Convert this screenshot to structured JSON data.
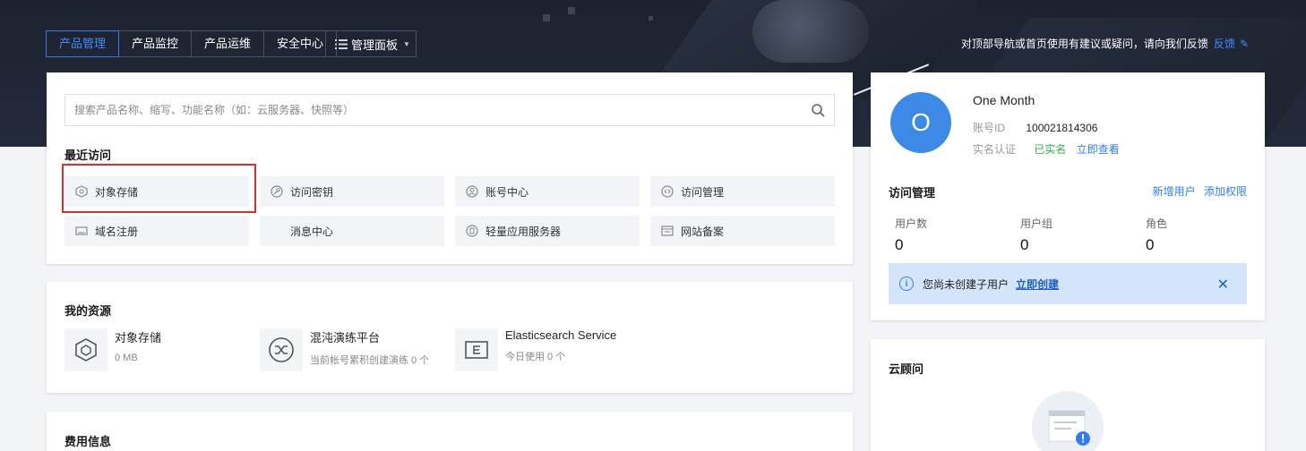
{
  "nav": {
    "tabs": [
      "产品管理",
      "产品监控",
      "产品运维",
      "安全中心"
    ],
    "active_tab": "产品管理",
    "panel_label": "管理面板"
  },
  "feedback": {
    "text": "对顶部导航或首页使用有建议或疑问，请向我们反馈",
    "link": "反馈"
  },
  "search": {
    "placeholder": "搜索产品名称、缩写、功能名称（如：云服务器、快照等）"
  },
  "recent": {
    "title": "最近访问",
    "items": [
      {
        "label": "对象存储",
        "icon": "cube-icon"
      },
      {
        "label": "访问密钥",
        "icon": "key-icon"
      },
      {
        "label": "账号中心",
        "icon": "user-icon"
      },
      {
        "label": "访问管理",
        "icon": "access-icon"
      },
      {
        "label": "域名注册",
        "icon": "domain-icon"
      },
      {
        "label": "消息中心",
        "icon": ""
      },
      {
        "label": "轻量应用服务器",
        "icon": "server-icon"
      },
      {
        "label": "网站备案",
        "icon": "record-icon"
      }
    ]
  },
  "resources": {
    "title": "我的资源",
    "items": [
      {
        "name": "对象存储",
        "sub": "0 MB",
        "icon": "cube-icon"
      },
      {
        "name": "混沌演练平台",
        "sub": "当前帐号累积创建演练 0 个",
        "icon": "shuffle-icon"
      },
      {
        "name": "Elasticsearch Service",
        "sub": "今日使用 0 个",
        "icon": "elasticsearch-icon"
      }
    ]
  },
  "billing": {
    "title": "费用信息"
  },
  "account": {
    "avatar_letter": "O",
    "name": "One Month",
    "id_label": "账号ID",
    "id_value": "100021814306",
    "auth_label": "实名认证",
    "auth_status": "已实名",
    "auth_link": "立即查看"
  },
  "access": {
    "title": "访问管理",
    "add_user": "新增用户",
    "add_permission": "添加权限",
    "stats": [
      {
        "label": "用户数",
        "value": "0"
      },
      {
        "label": "用户组",
        "value": "0"
      },
      {
        "label": "角色",
        "value": "0"
      }
    ],
    "notice_text": "您尚未创建子用户",
    "notice_link": "立即创建"
  },
  "advisor": {
    "title": "云顾问"
  },
  "colors": {
    "accent": "#2f7df6",
    "banner": "#1d2230",
    "highlight": "#d92e2e",
    "avatar": "#3d8ae6",
    "success": "#2bb24c"
  }
}
